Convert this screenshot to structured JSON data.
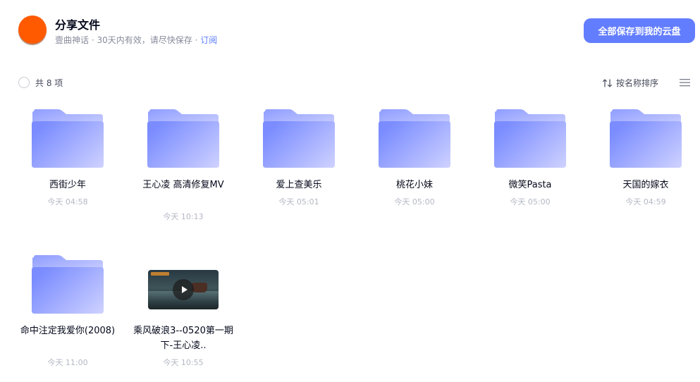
{
  "header": {
    "title": "分享文件",
    "owner": "壹曲神话",
    "validity": "30天内有效，请尽快保存",
    "separator": " · ",
    "subscribe_label": "订阅",
    "save_all_label": "全部保存到我的云盘",
    "avatar_color": "#ff5a00",
    "accent_color": "#637dff"
  },
  "toolbar": {
    "count_label": "共 8 项",
    "sort_label": "按名称排序",
    "sort_icon": "sort-arrows-icon",
    "view_icon": "list-view-icon"
  },
  "items": [
    {
      "type": "folder",
      "name": "西街少年",
      "time": "今天 04:58"
    },
    {
      "type": "folder",
      "name": "王心凌 高清修复MV",
      "time": "今天 10:13"
    },
    {
      "type": "folder",
      "name": "爱上查美乐",
      "time": "今天 05:01"
    },
    {
      "type": "folder",
      "name": "桃花小妹",
      "time": "今天 05:00"
    },
    {
      "type": "folder",
      "name": "微笑Pasta",
      "time": "今天 05:00"
    },
    {
      "type": "folder",
      "name": "天国的嫁衣",
      "time": "今天 04:59"
    },
    {
      "type": "folder",
      "name": "命中注定我爱你(2008)",
      "time": "今天 11:00"
    },
    {
      "type": "video",
      "name": "乘风破浪3--0520第一期下-王心凌..",
      "time": "今天 10:55"
    }
  ]
}
